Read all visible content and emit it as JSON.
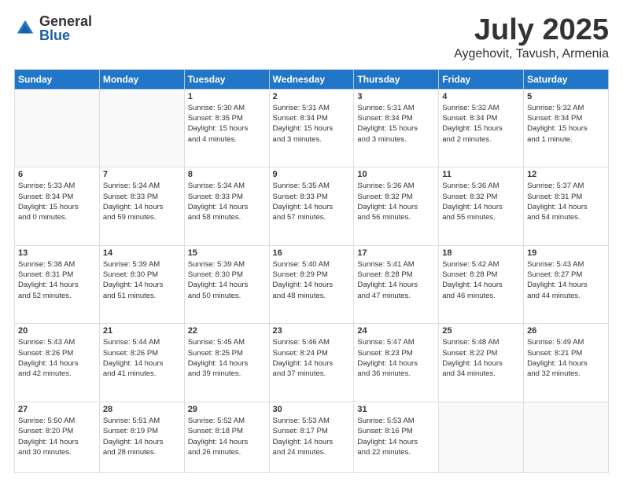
{
  "header": {
    "logo_general": "General",
    "logo_blue": "Blue",
    "month_title": "July 2025",
    "location": "Aygehovit, Tavush, Armenia"
  },
  "days_of_week": [
    "Sunday",
    "Monday",
    "Tuesday",
    "Wednesday",
    "Thursday",
    "Friday",
    "Saturday"
  ],
  "weeks": [
    [
      {
        "day": "",
        "detail": ""
      },
      {
        "day": "",
        "detail": ""
      },
      {
        "day": "1",
        "detail": "Sunrise: 5:30 AM\nSunset: 8:35 PM\nDaylight: 15 hours\nand 4 minutes."
      },
      {
        "day": "2",
        "detail": "Sunrise: 5:31 AM\nSunset: 8:34 PM\nDaylight: 15 hours\nand 3 minutes."
      },
      {
        "day": "3",
        "detail": "Sunrise: 5:31 AM\nSunset: 8:34 PM\nDaylight: 15 hours\nand 3 minutes."
      },
      {
        "day": "4",
        "detail": "Sunrise: 5:32 AM\nSunset: 8:34 PM\nDaylight: 15 hours\nand 2 minutes."
      },
      {
        "day": "5",
        "detail": "Sunrise: 5:32 AM\nSunset: 8:34 PM\nDaylight: 15 hours\nand 1 minute."
      }
    ],
    [
      {
        "day": "6",
        "detail": "Sunrise: 5:33 AM\nSunset: 8:34 PM\nDaylight: 15 hours\nand 0 minutes."
      },
      {
        "day": "7",
        "detail": "Sunrise: 5:34 AM\nSunset: 8:33 PM\nDaylight: 14 hours\nand 59 minutes."
      },
      {
        "day": "8",
        "detail": "Sunrise: 5:34 AM\nSunset: 8:33 PM\nDaylight: 14 hours\nand 58 minutes."
      },
      {
        "day": "9",
        "detail": "Sunrise: 5:35 AM\nSunset: 8:33 PM\nDaylight: 14 hours\nand 57 minutes."
      },
      {
        "day": "10",
        "detail": "Sunrise: 5:36 AM\nSunset: 8:32 PM\nDaylight: 14 hours\nand 56 minutes."
      },
      {
        "day": "11",
        "detail": "Sunrise: 5:36 AM\nSunset: 8:32 PM\nDaylight: 14 hours\nand 55 minutes."
      },
      {
        "day": "12",
        "detail": "Sunrise: 5:37 AM\nSunset: 8:31 PM\nDaylight: 14 hours\nand 54 minutes."
      }
    ],
    [
      {
        "day": "13",
        "detail": "Sunrise: 5:38 AM\nSunset: 8:31 PM\nDaylight: 14 hours\nand 52 minutes."
      },
      {
        "day": "14",
        "detail": "Sunrise: 5:39 AM\nSunset: 8:30 PM\nDaylight: 14 hours\nand 51 minutes."
      },
      {
        "day": "15",
        "detail": "Sunrise: 5:39 AM\nSunset: 8:30 PM\nDaylight: 14 hours\nand 50 minutes."
      },
      {
        "day": "16",
        "detail": "Sunrise: 5:40 AM\nSunset: 8:29 PM\nDaylight: 14 hours\nand 48 minutes."
      },
      {
        "day": "17",
        "detail": "Sunrise: 5:41 AM\nSunset: 8:28 PM\nDaylight: 14 hours\nand 47 minutes."
      },
      {
        "day": "18",
        "detail": "Sunrise: 5:42 AM\nSunset: 8:28 PM\nDaylight: 14 hours\nand 46 minutes."
      },
      {
        "day": "19",
        "detail": "Sunrise: 5:43 AM\nSunset: 8:27 PM\nDaylight: 14 hours\nand 44 minutes."
      }
    ],
    [
      {
        "day": "20",
        "detail": "Sunrise: 5:43 AM\nSunset: 8:26 PM\nDaylight: 14 hours\nand 42 minutes."
      },
      {
        "day": "21",
        "detail": "Sunrise: 5:44 AM\nSunset: 8:26 PM\nDaylight: 14 hours\nand 41 minutes."
      },
      {
        "day": "22",
        "detail": "Sunrise: 5:45 AM\nSunset: 8:25 PM\nDaylight: 14 hours\nand 39 minutes."
      },
      {
        "day": "23",
        "detail": "Sunrise: 5:46 AM\nSunset: 8:24 PM\nDaylight: 14 hours\nand 37 minutes."
      },
      {
        "day": "24",
        "detail": "Sunrise: 5:47 AM\nSunset: 8:23 PM\nDaylight: 14 hours\nand 36 minutes."
      },
      {
        "day": "25",
        "detail": "Sunrise: 5:48 AM\nSunset: 8:22 PM\nDaylight: 14 hours\nand 34 minutes."
      },
      {
        "day": "26",
        "detail": "Sunrise: 5:49 AM\nSunset: 8:21 PM\nDaylight: 14 hours\nand 32 minutes."
      }
    ],
    [
      {
        "day": "27",
        "detail": "Sunrise: 5:50 AM\nSunset: 8:20 PM\nDaylight: 14 hours\nand 30 minutes."
      },
      {
        "day": "28",
        "detail": "Sunrise: 5:51 AM\nSunset: 8:19 PM\nDaylight: 14 hours\nand 28 minutes."
      },
      {
        "day": "29",
        "detail": "Sunrise: 5:52 AM\nSunset: 8:18 PM\nDaylight: 14 hours\nand 26 minutes."
      },
      {
        "day": "30",
        "detail": "Sunrise: 5:53 AM\nSunset: 8:17 PM\nDaylight: 14 hours\nand 24 minutes."
      },
      {
        "day": "31",
        "detail": "Sunrise: 5:53 AM\nSunset: 8:16 PM\nDaylight: 14 hours\nand 22 minutes."
      },
      {
        "day": "",
        "detail": ""
      },
      {
        "day": "",
        "detail": ""
      }
    ]
  ]
}
